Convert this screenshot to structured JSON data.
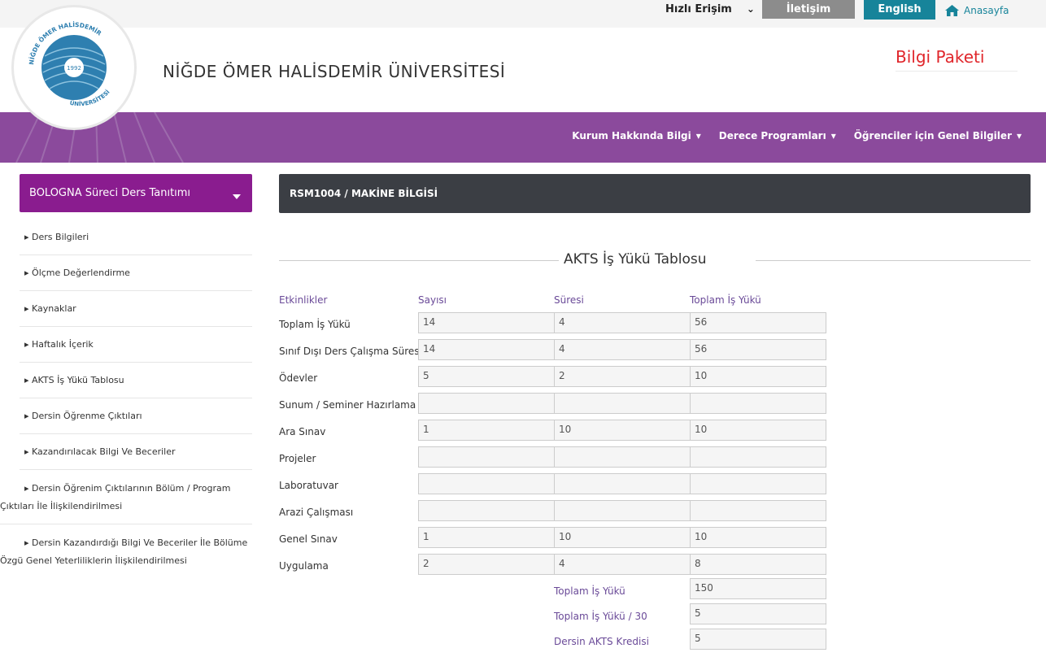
{
  "topbar": {
    "quick_access": "Hızlı Erişim",
    "contact": "İletişim",
    "english": "English",
    "home": "Anasayfa"
  },
  "header": {
    "logo_text": {
      "top": "NİĞDE ÖMER HALİSDEMİR",
      "bottom": "ÜNİVERSİTESİ",
      "year": "1992"
    },
    "title": "NİĞDE ÖMER HALİSDEMİR ÜNİVERSİTESİ",
    "bilgi_paketi": "Bilgi Paketi"
  },
  "nav": {
    "items": [
      {
        "label": "Kurum Hakkında Bilgi"
      },
      {
        "label": "Derece Programları"
      },
      {
        "label": "Öğrenciler için Genel Bilgiler"
      }
    ]
  },
  "sidebar": {
    "title": "BOLOGNA Süreci Ders Tanıtımı",
    "items": [
      {
        "label": "Ders Bilgileri"
      },
      {
        "label": "Ölçme Değerlendirme"
      },
      {
        "label": "Kaynaklar"
      },
      {
        "label": "Haftalık İçerik"
      },
      {
        "label": "AKTS İş Yükü Tablosu"
      },
      {
        "label": "Dersin Öğrenme Çıktıları"
      },
      {
        "label": "Kazandırılacak Bilgi Ve Beceriler"
      },
      {
        "label": "Dersin Öğrenim Çıktılarının Bölüm / Program Çıktıları İle İlişkilendirilmesi"
      },
      {
        "label": "Dersin Kazandırdığı Bilgi Ve Beceriler İle Bölüme Özgü Genel Yeterliliklerin İlişkilendirilmesi"
      }
    ]
  },
  "main": {
    "course": "RSM1004 / MAKİNE BİLGİSİ",
    "section_title": "AKTS İş Yükü Tablosu",
    "table": {
      "headers": [
        "Etkinlikler",
        "Sayısı",
        "Süresi",
        "Toplam İş Yükü"
      ],
      "rows": [
        {
          "activity": "Toplam İş Yükü",
          "count": "14",
          "duration": "4",
          "total": "56"
        },
        {
          "activity": "Sınıf Dışı Ders Çalışma Süresi",
          "count": "14",
          "duration": "4",
          "total": "56"
        },
        {
          "activity": "Ödevler",
          "count": "5",
          "duration": "2",
          "total": "10"
        },
        {
          "activity": "Sunum / Seminer Hazırlama",
          "count": "",
          "duration": "",
          "total": ""
        },
        {
          "activity": "Ara Sınav",
          "count": "1",
          "duration": "10",
          "total": "10"
        },
        {
          "activity": "Projeler",
          "count": "",
          "duration": "",
          "total": ""
        },
        {
          "activity": "Laboratuvar",
          "count": "",
          "duration": "",
          "total": ""
        },
        {
          "activity": "Arazi Çalışması",
          "count": "",
          "duration": "",
          "total": ""
        },
        {
          "activity": "Genel Sınav",
          "count": "1",
          "duration": "10",
          "total": "10"
        },
        {
          "activity": "Uygulama",
          "count": "2",
          "duration": "4",
          "total": "8"
        }
      ]
    },
    "summary": [
      {
        "label": "Toplam İş Yükü",
        "value": "150"
      },
      {
        "label": "Toplam İş Yükü / 30",
        "value": "5"
      },
      {
        "label": "Dersin AKTS Kredisi",
        "value": "5"
      }
    ]
  },
  "colors": {
    "nav_purple": "#8b4a9c",
    "sidebar_button": "#8a1c8f",
    "course_bar": "#3b3e44",
    "english_button": "#17849a",
    "contact_button": "#8c8c8c",
    "bilgi_paketi_red": "#e0262b",
    "header_label_purple": "#6a4a98"
  }
}
